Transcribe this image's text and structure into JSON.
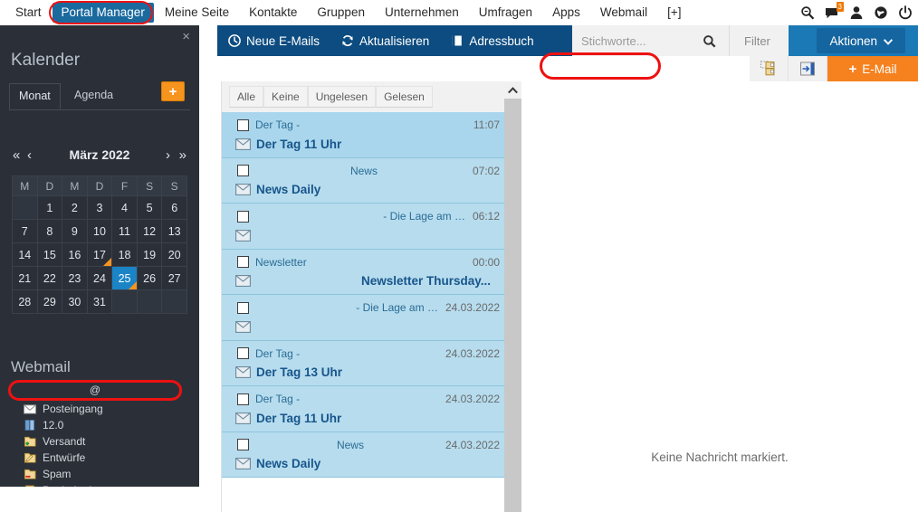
{
  "topnav": {
    "items": [
      {
        "label": "Start",
        "active": false
      },
      {
        "label": "Portal Manager",
        "active": true
      },
      {
        "label": "Meine Seite",
        "active": false
      },
      {
        "label": "Kontakte",
        "active": false
      },
      {
        "label": "Gruppen",
        "active": false
      },
      {
        "label": "Unternehmen",
        "active": false
      },
      {
        "label": "Umfragen",
        "active": false
      },
      {
        "label": "Apps",
        "active": false
      },
      {
        "label": "Webmail",
        "active": false
      },
      {
        "label": "[+]",
        "active": false
      }
    ],
    "icons": [
      {
        "name": "search-icon"
      },
      {
        "name": "messages-icon",
        "badge": "3"
      },
      {
        "name": "user-icon"
      },
      {
        "name": "globe-help-icon"
      },
      {
        "name": "power-icon"
      }
    ]
  },
  "sidebar": {
    "close_label": "×",
    "title": "Kalender",
    "tabs": [
      {
        "label": "Monat",
        "active": true
      },
      {
        "label": "Agenda",
        "active": false
      }
    ],
    "add_label": "+",
    "calendar": {
      "prev_year_label": "«",
      "prev_month_label": "‹",
      "next_month_label": "›",
      "next_year_label": "»",
      "month_label": "März 2022",
      "weekdays": [
        "M",
        "D",
        "M",
        "D",
        "F",
        "S",
        "S"
      ],
      "weeks": [
        [
          {
            "d": ""
          },
          {
            "d": "1"
          },
          {
            "d": "2"
          },
          {
            "d": "3"
          },
          {
            "d": "4"
          },
          {
            "d": "5"
          },
          {
            "d": "6"
          }
        ],
        [
          {
            "d": "7"
          },
          {
            "d": "8"
          },
          {
            "d": "9"
          },
          {
            "d": "10"
          },
          {
            "d": "11"
          },
          {
            "d": "12"
          },
          {
            "d": "13"
          }
        ],
        [
          {
            "d": "14"
          },
          {
            "d": "15"
          },
          {
            "d": "16"
          },
          {
            "d": "17",
            "mark": true
          },
          {
            "d": "18"
          },
          {
            "d": "19"
          },
          {
            "d": "20"
          }
        ],
        [
          {
            "d": "21"
          },
          {
            "d": "22"
          },
          {
            "d": "23"
          },
          {
            "d": "24"
          },
          {
            "d": "25",
            "mark": true,
            "selected": true
          },
          {
            "d": "26"
          },
          {
            "d": "27"
          }
        ],
        [
          {
            "d": "28"
          },
          {
            "d": "29"
          },
          {
            "d": "30"
          },
          {
            "d": "31"
          },
          {
            "d": ""
          },
          {
            "d": ""
          },
          {
            "d": ""
          }
        ]
      ]
    },
    "webmail": {
      "title": "Webmail",
      "account_label": "@",
      "folders": [
        {
          "label": "Posteingang",
          "icon": "inbox-envelope-icon"
        },
        {
          "label": "12.0",
          "icon": "book-icon"
        },
        {
          "label": "Versandt",
          "icon": "folder-sent-icon"
        },
        {
          "label": "Entwürfe",
          "icon": "folder-draft-icon"
        },
        {
          "label": "Spam",
          "icon": "folder-spam-icon"
        },
        {
          "label": "Papierkorb",
          "icon": "trash-icon"
        }
      ]
    }
  },
  "toolbar": {
    "new_mails_label": "Neue E-Mails",
    "refresh_label": "Aktualisieren",
    "addressbook_label": "Adressbuch",
    "search_placeholder": "Stichworte...",
    "filter_label": "Filter",
    "actions_label": "Aktionen",
    "actions_caret": "⌄",
    "new_email_label": "E-Mail",
    "new_email_plus": "+"
  },
  "list": {
    "filters": [
      "Alle",
      "Keine",
      "Ungelesen",
      "Gelesen"
    ],
    "messages": [
      {
        "sender": "Der Tag -",
        "subject": "Der Tag 11 Uhr",
        "time": "11:07",
        "sender_align": "l",
        "subject_align": "l",
        "selected": true
      },
      {
        "sender": "News",
        "subject": "News Daily",
        "time": "07:02",
        "sender_align": "c",
        "subject_align": "l",
        "selected": false
      },
      {
        "sender": "- Die Lage am …",
        "subject": "",
        "time": "06:12",
        "sender_align": "r",
        "subject_align": "l",
        "selected": false
      },
      {
        "sender": "Newsletter",
        "subject": "Newsletter Thursday...",
        "time": "00:00",
        "sender_align": "l",
        "subject_align": "r",
        "selected": false
      },
      {
        "sender": "- Die Lage am …",
        "subject": "",
        "time": "24.03.2022",
        "sender_align": "r",
        "subject_align": "l",
        "selected": false
      },
      {
        "sender": "Der Tag -",
        "subject": "Der Tag 13 Uhr",
        "time": "24.03.2022",
        "sender_align": "l",
        "subject_align": "l",
        "selected": false
      },
      {
        "sender": "Der Tag -",
        "subject": "Der Tag 11 Uhr",
        "time": "24.03.2022",
        "sender_align": "l",
        "subject_align": "l",
        "selected": false
      },
      {
        "sender": "News",
        "subject": "News Daily",
        "time": "24.03.2022",
        "sender_align": "c",
        "subject_align": "l",
        "selected": false
      }
    ]
  },
  "readpane": {
    "empty_message": "Keine Nachricht markiert."
  },
  "colors": {
    "nav_active": "#1a6a9e",
    "toolbar_dark": "#0d4c80",
    "toolbar_light": "#1b79b5",
    "accent_orange": "#f5811f",
    "annotation_red": "#ee1111",
    "sidebar_bg": "#2b3038",
    "row_blue": "#b6dcee",
    "selected_day": "#1a84c7"
  }
}
